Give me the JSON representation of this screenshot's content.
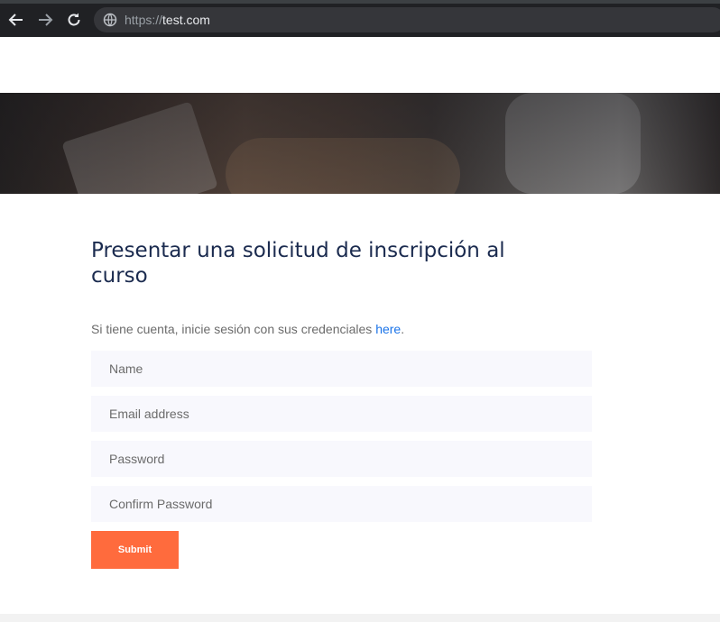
{
  "browser": {
    "url_scheme": "https://",
    "url_host": "test.com",
    "icons": [
      "back-arrow-icon",
      "forward-arrow-icon",
      "reload-icon",
      "site-info-icon"
    ]
  },
  "page": {
    "title": "Presentar una solicitud de inscripción al curso",
    "intro_text": "Si tiene cuenta, inicie sesión con sus credenciales ",
    "intro_link": "here",
    "intro_end": "."
  },
  "form": {
    "name_placeholder": "Name",
    "email_placeholder": "Email address",
    "password_placeholder": "Password",
    "confirm_placeholder": "Confirm Password",
    "submit_label": "Submit"
  },
  "colors": {
    "accent": "#ff6b3d",
    "title": "#1b2b4f",
    "link": "#1a73e8",
    "field_bg": "#f8f8fd"
  }
}
